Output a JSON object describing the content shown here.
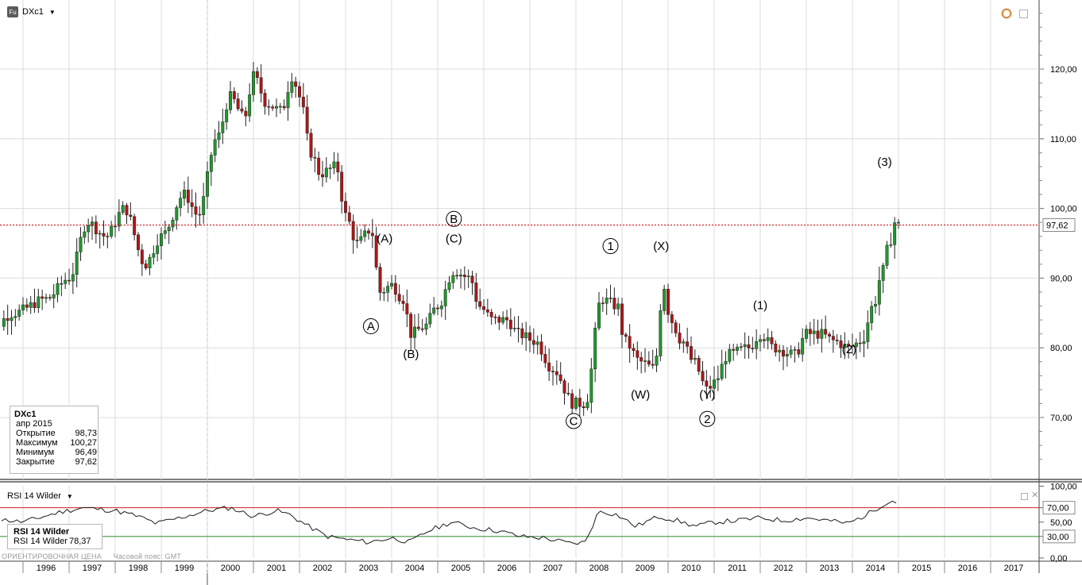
{
  "header": {
    "symbol": "DXc1"
  },
  "info_box": {
    "title": "DXc1",
    "period": "апр 2015",
    "rows": [
      {
        "label": "Открытие",
        "value": "98,73"
      },
      {
        "label": "Максимум",
        "value": "100,27"
      },
      {
        "label": "Минимум",
        "value": "96,49"
      },
      {
        "label": "Закрытие",
        "value": "97,62"
      }
    ]
  },
  "rsi_panel": {
    "title": "RSI 14 Wilder",
    "box_title": "RSI 14 Wilder",
    "box_label": "RSI 14 Wilder",
    "box_value": "78,37"
  },
  "footer": {
    "left": "ОРИЕНТИРОВОЧНАЯ ЦЕНА",
    "right": "Часовой пояс: GMT"
  },
  "colors": {
    "up": "#1f9a2a",
    "down": "#b31515",
    "price_line": "#cc0000",
    "rsi_line": "#1a1a1a",
    "rsi_upper": "#cc2222",
    "rsi_lower": "#2a8a2a",
    "grid": "#dcdcdc"
  },
  "chart_data": {
    "type": "candlestick",
    "x_labels": [
      "1996",
      "1997",
      "1998",
      "1999",
      "2000",
      "2001",
      "2002",
      "2003",
      "2004",
      "2005",
      "2006",
      "2007",
      "2008",
      "2009",
      "2010",
      "2011",
      "2012",
      "2013",
      "2014",
      "2015",
      "2016",
      "2017"
    ],
    "y_ticks": [
      "120,00",
      "110,00",
      "100,00",
      "90,00",
      "80,00",
      "70,00"
    ],
    "y_range": [
      62,
      129
    ],
    "last_price": 97.62,
    "last_price_label": "97,62",
    "wave_labels": [
      {
        "text": "A",
        "date": 2003.55,
        "value": 83.1,
        "circled": true
      },
      {
        "text": "(A)",
        "date": 2003.85,
        "value": 95.7,
        "circled": false
      },
      {
        "text": "(B)",
        "date": 2004.42,
        "value": 79.1,
        "circled": false
      },
      {
        "text": "B",
        "date": 2005.35,
        "value": 98.5,
        "circled": true
      },
      {
        "text": "(C)",
        "date": 2005.35,
        "value": 95.7,
        "circled": false
      },
      {
        "text": "C",
        "date": 2007.95,
        "value": 69.5,
        "circled": true
      },
      {
        "text": "1",
        "date": 2008.75,
        "value": 94.6,
        "circled": true
      },
      {
        "text": "(X)",
        "date": 2009.85,
        "value": 94.6,
        "circled": false
      },
      {
        "text": "(W)",
        "date": 2009.4,
        "value": 73.3,
        "circled": false
      },
      {
        "text": "(Y)",
        "date": 2010.85,
        "value": 73.3,
        "circled": false
      },
      {
        "text": "2",
        "date": 2010.85,
        "value": 69.8,
        "circled": true
      },
      {
        "text": "(1)",
        "date": 2012.0,
        "value": 86.1,
        "circled": false
      },
      {
        "text": "(2)",
        "date": 2013.93,
        "value": 79.8,
        "circled": false
      },
      {
        "text": "(3)",
        "date": 2014.7,
        "value": 106.7,
        "circled": false
      }
    ],
    "anchors": [
      [
        1995.2,
        82
      ],
      [
        1995.8,
        85
      ],
      [
        1996.5,
        87
      ],
      [
        1997.0,
        90
      ],
      [
        1997.4,
        98
      ],
      [
        1997.8,
        96
      ],
      [
        1998.2,
        100
      ],
      [
        1998.65,
        92
      ],
      [
        1999.0,
        96
      ],
      [
        1999.5,
        102
      ],
      [
        1999.8,
        99
      ],
      [
        2000.2,
        110
      ],
      [
        2000.5,
        116
      ],
      [
        2000.8,
        113
      ],
      [
        2001.0,
        119
      ],
      [
        2001.3,
        115
      ],
      [
        2001.6,
        114
      ],
      [
        2001.85,
        119
      ],
      [
        2002.0,
        116
      ],
      [
        2002.25,
        108
      ],
      [
        2002.45,
        105
      ],
      [
        2002.8,
        106
      ],
      [
        2003.0,
        99
      ],
      [
        2003.25,
        95
      ],
      [
        2003.55,
        97
      ],
      [
        2003.75,
        88
      ],
      [
        2004.0,
        89
      ],
      [
        2004.25,
        87
      ],
      [
        2004.42,
        82
      ],
      [
        2004.7,
        83
      ],
      [
        2005.0,
        86
      ],
      [
        2005.35,
        91
      ],
      [
        2005.7,
        90
      ],
      [
        2005.9,
        86
      ],
      [
        2006.2,
        84
      ],
      [
        2006.5,
        84
      ],
      [
        2006.75,
        82
      ],
      [
        2007.1,
        81
      ],
      [
        2007.5,
        77
      ],
      [
        2007.95,
        72
      ],
      [
        2008.2,
        72
      ],
      [
        2008.55,
        87
      ],
      [
        2008.9,
        86
      ],
      [
        2009.05,
        81
      ],
      [
        2009.4,
        78
      ],
      [
        2009.7,
        77
      ],
      [
        2009.9,
        89
      ],
      [
        2010.05,
        84
      ],
      [
        2010.3,
        81
      ],
      [
        2010.55,
        78
      ],
      [
        2010.85,
        74
      ],
      [
        2011.0,
        75
      ],
      [
        2011.3,
        79
      ],
      [
        2011.75,
        80
      ],
      [
        2012.0,
        82
      ],
      [
        2012.3,
        80
      ],
      [
        2012.75,
        79
      ],
      [
        2013.0,
        82
      ],
      [
        2013.3,
        82
      ],
      [
        2013.6,
        81
      ],
      [
        2013.93,
        80
      ],
      [
        2014.2,
        81
      ],
      [
        2014.45,
        86
      ],
      [
        2014.65,
        91
      ],
      [
        2014.8,
        95
      ],
      [
        2014.92,
        98
      ],
      [
        2015.0,
        97.6
      ]
    ],
    "rsi": {
      "y_ticks": [
        "100,00",
        "70,00",
        "50,00",
        "30,00",
        "0,00"
      ],
      "levels": [
        70,
        30
      ],
      "upper_label": "70,00",
      "lower_label": "30,00",
      "anchors": [
        [
          1995.2,
          56
        ],
        [
          1996.0,
          50
        ],
        [
          1996.8,
          64
        ],
        [
          1997.3,
          70
        ],
        [
          1998.0,
          66
        ],
        [
          1998.5,
          58
        ],
        [
          1998.9,
          48
        ],
        [
          1999.4,
          56
        ],
        [
          2000.0,
          66
        ],
        [
          2000.5,
          70
        ],
        [
          2001.0,
          58
        ],
        [
          2001.5,
          66
        ],
        [
          2001.8,
          60
        ],
        [
          2002.2,
          44
        ],
        [
          2002.6,
          30
        ],
        [
          2003.0,
          26
        ],
        [
          2003.5,
          22
        ],
        [
          2004.0,
          28
        ],
        [
          2004.4,
          22
        ],
        [
          2004.8,
          38
        ],
        [
          2005.3,
          50
        ],
        [
          2005.8,
          42
        ],
        [
          2006.3,
          38
        ],
        [
          2006.8,
          30
        ],
        [
          2007.3,
          28
        ],
        [
          2007.9,
          20
        ],
        [
          2008.2,
          22
        ],
        [
          2008.5,
          66
        ],
        [
          2008.9,
          60
        ],
        [
          2009.3,
          44
        ],
        [
          2009.8,
          58
        ],
        [
          2010.2,
          52
        ],
        [
          2010.6,
          44
        ],
        [
          2011.0,
          50
        ],
        [
          2011.5,
          52
        ],
        [
          2012.0,
          56
        ],
        [
          2012.5,
          52
        ],
        [
          2013.0,
          56
        ],
        [
          2013.5,
          52
        ],
        [
          2013.9,
          48
        ],
        [
          2014.3,
          60
        ],
        [
          2014.7,
          76
        ],
        [
          2014.85,
          80
        ],
        [
          2015.0,
          76
        ]
      ]
    }
  }
}
